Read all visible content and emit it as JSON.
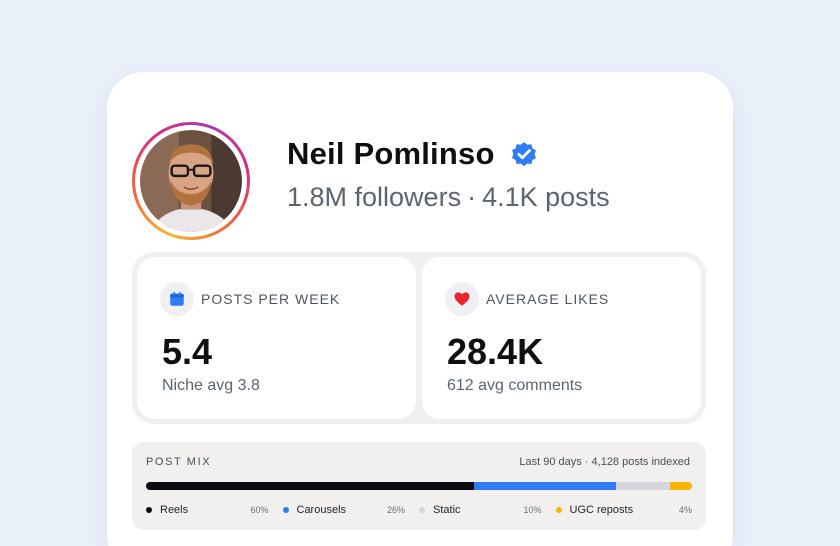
{
  "profile": {
    "name": "Neil Pomlinso",
    "followers": "1.8M followers",
    "separator": "·",
    "posts": "4.1K posts",
    "verified_icon": "verified-badge-icon"
  },
  "colors": {
    "verified": "#2f7cf6",
    "calendar": "#2f7cf6",
    "heart": "#e8262f"
  },
  "stats": [
    {
      "icon": "calendar-icon",
      "label": "POSTS PER WEEK",
      "value": "5.4",
      "sub": "Niche avg 3.8"
    },
    {
      "icon": "heart-icon",
      "label": "AVERAGE LIKES",
      "value": "28.4K",
      "sub": "612 avg comments"
    }
  ],
  "post_mix": {
    "title": "POST MIX",
    "meta": "Last 90 days · 4,128 posts indexed",
    "segments": [
      {
        "label": "Reels",
        "pct_text": "60%",
        "fraction": 0.6,
        "color": "#0b0c0f"
      },
      {
        "label": "Carousels",
        "pct_text": "26%",
        "fraction": 0.26,
        "color": "#2f7cf6"
      },
      {
        "label": "Static",
        "pct_text": "10%",
        "fraction": 0.1,
        "color": "#d5d7db"
      },
      {
        "label": "UGC reposts",
        "pct_text": "4%",
        "fraction": 0.04,
        "color": "#f8b600"
      }
    ]
  }
}
